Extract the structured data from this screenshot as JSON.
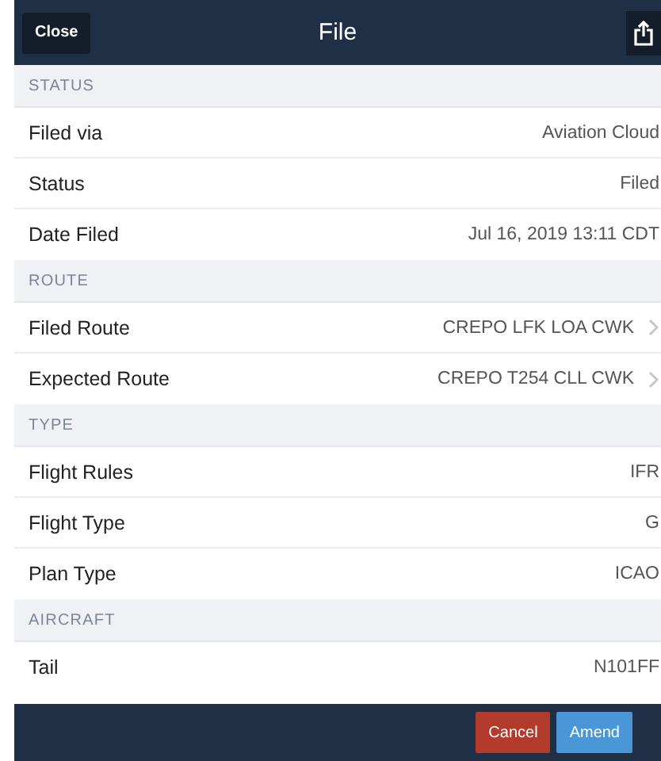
{
  "header": {
    "close": "Close",
    "title": "File"
  },
  "sections": [
    {
      "title": "STATUS",
      "rows": [
        {
          "label": "Filed via",
          "value": "Aviation Cloud",
          "link": false
        },
        {
          "label": "Status",
          "value": "Filed",
          "link": false
        },
        {
          "label": "Date Filed",
          "value": "Jul 16, 2019 13:11 CDT",
          "link": false
        }
      ]
    },
    {
      "title": "ROUTE",
      "rows": [
        {
          "label": "Filed Route",
          "value": "CREPO LFK LOA CWK",
          "link": true
        },
        {
          "label": "Expected Route",
          "value": "CREPO T254 CLL CWK",
          "link": true
        }
      ]
    },
    {
      "title": "TYPE",
      "rows": [
        {
          "label": "Flight Rules",
          "value": "IFR",
          "link": false
        },
        {
          "label": "Flight Type",
          "value": "G",
          "link": false
        },
        {
          "label": "Plan Type",
          "value": "ICAO",
          "link": false
        }
      ]
    },
    {
      "title": "AIRCRAFT",
      "rows": [
        {
          "label": "Tail",
          "value": "N101FF",
          "link": false
        }
      ]
    }
  ],
  "footer": {
    "cancel": "Cancel",
    "amend": "Amend"
  }
}
